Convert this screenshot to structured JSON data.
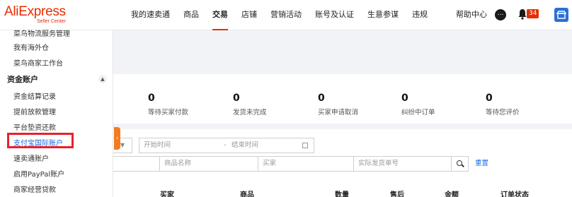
{
  "logo": {
    "main": "AliExpress",
    "sub": "Seller Center"
  },
  "nav": [
    "我的速卖通",
    "商品",
    "交易",
    "店铺",
    "营销活动",
    "账号及认证",
    "生意参谋",
    "违规"
  ],
  "nav_active_index": 2,
  "header": {
    "help": "帮助中心",
    "badge_count": "34"
  },
  "sidebar": {
    "items_top": [
      "菜鸟物流服务管理",
      "我有海外仓",
      "菜鸟商家工作台"
    ],
    "group": "资金账户",
    "group_items": [
      "资金结算记录",
      "提前放款管理",
      "平台垫资还款",
      "支付宝国际账户",
      "速卖通账户",
      "启用PayPal账户",
      "商家经营贷款"
    ],
    "highlighted_index": 3
  },
  "stats": [
    {
      "value": "0",
      "label": "等待买家付款"
    },
    {
      "value": "0",
      "label": "发货未完成"
    },
    {
      "value": "0",
      "label": "买家申请取消"
    },
    {
      "value": "0",
      "label": "纠纷中订单"
    },
    {
      "value": "0",
      "label": "等待您评价"
    }
  ],
  "filters": {
    "date_start_placeholder": "开始时间",
    "date_separator": "-",
    "date_end_placeholder": "结束时间",
    "product_name_placeholder": "商品名称",
    "buyer_placeholder": "买家",
    "tracking_placeholder": "实际发货单号",
    "reset_label": "重置"
  },
  "table_headers": [
    "买家",
    "商品",
    "数量",
    "售后",
    "金额",
    "订单状态"
  ],
  "colors": {
    "brand": "#e62e04",
    "highlight_box": "#e8212c",
    "link": "#1a6ae0",
    "collapse_tab": "#f47b20"
  }
}
